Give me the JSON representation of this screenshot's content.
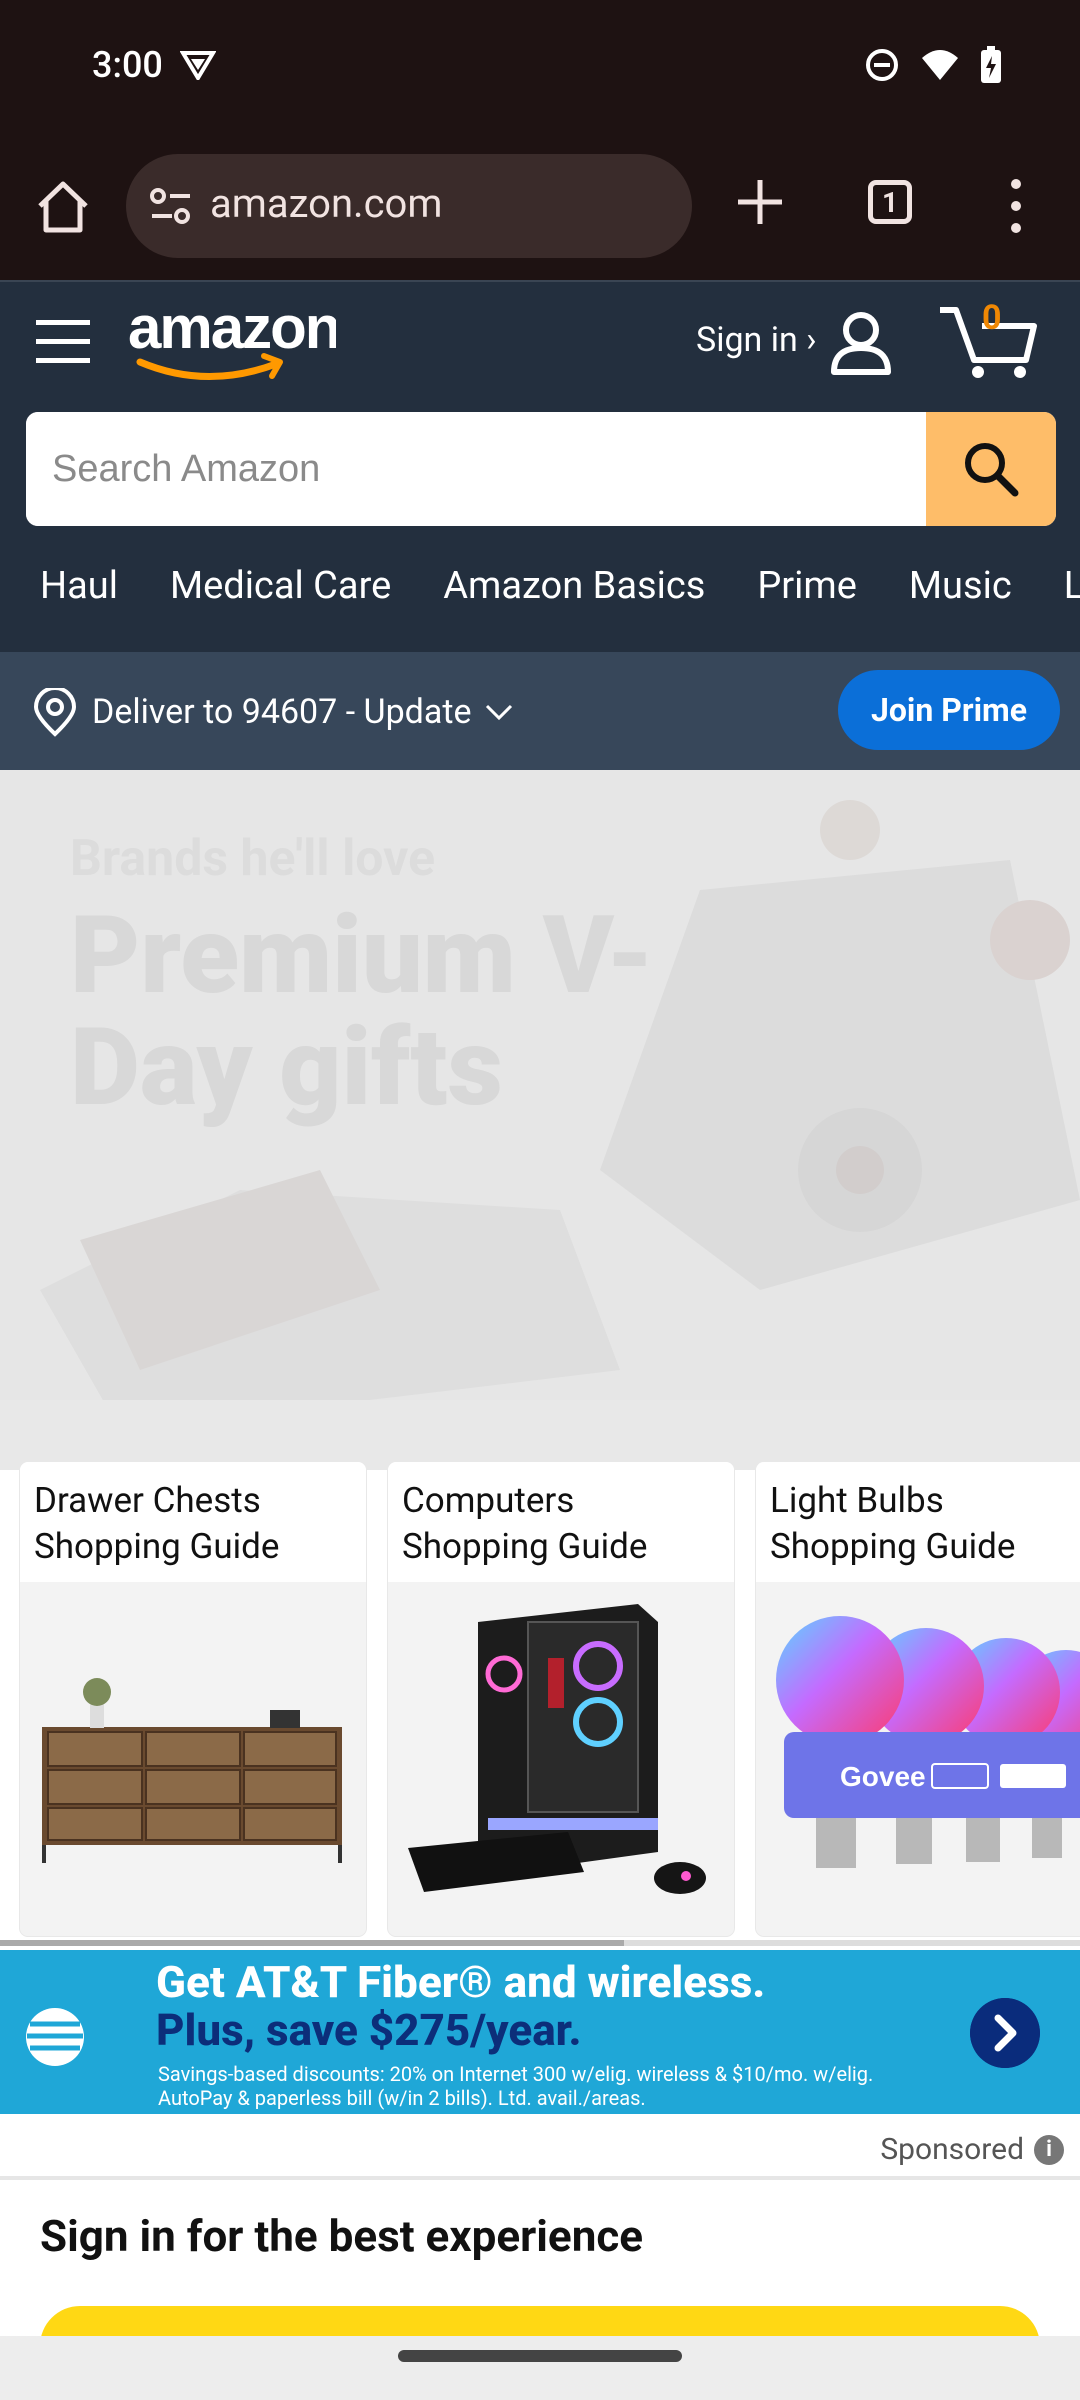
{
  "status_bar": {
    "time": "3:00"
  },
  "browser": {
    "url": "amazon.com",
    "tab_count": "1"
  },
  "header": {
    "logo_text": "amazon",
    "signin_label": "Sign in ›",
    "cart_count": "0",
    "search_placeholder": "Search Amazon",
    "nav_items": [
      "Haul",
      "Medical Care",
      "Amazon Basics",
      "Prime",
      "Music",
      "L"
    ]
  },
  "delivery": {
    "text": "Deliver to 94607 - Update",
    "join_prime_label": "Join Prime"
  },
  "hero": {
    "subtitle": "Brands he'll love",
    "title": "Premium V-Day gifts"
  },
  "cards": [
    {
      "title": "Drawer Chests Shopping Guide"
    },
    {
      "title": "Computers Shopping Guide"
    },
    {
      "title": "Light Bulbs Shopping Guide"
    }
  ],
  "ad": {
    "headline_1": "Get AT&T Fiber® and wireless.",
    "headline_2": "Plus, save $275/year.",
    "fine_print": "Savings-based discounts: 20% on Internet 300 w/elig. wireless & $10/mo. w/elig. AutoPay & paperless bill (w/in 2 bills). Ltd. avail./areas.",
    "sponsored_label": "Sponsored"
  },
  "signin_section": {
    "heading": "Sign in for the best experience"
  },
  "colors": {
    "amazon_dark": "#232f3e",
    "amazon_nav2": "#37475a",
    "search_button": "#febd69",
    "prime_blue": "#0b6fd8",
    "att_blue": "#1fa7d7",
    "signin_yellow": "#ffd814"
  }
}
